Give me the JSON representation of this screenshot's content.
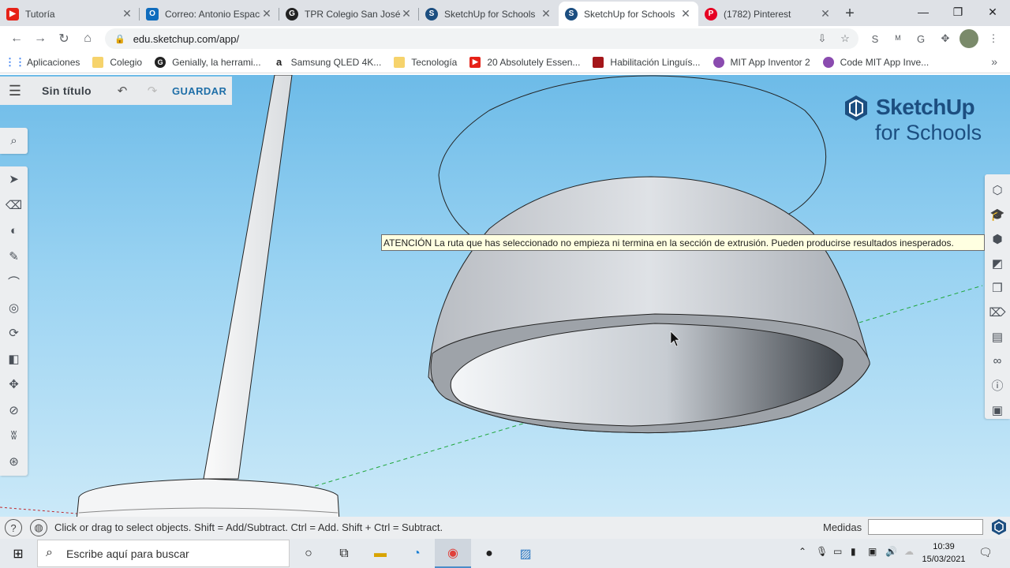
{
  "browser": {
    "tabs": [
      {
        "title": "Tutoría",
        "icon": "youtube-icon",
        "color": "#e62117",
        "active": false
      },
      {
        "title": "Correo: Antonio Espacio",
        "icon": "outlook-icon",
        "color": "#0f6cbd",
        "active": false
      },
      {
        "title": "TPR Colegio San José p",
        "icon": "genially-icon",
        "color": "#222222",
        "active": false
      },
      {
        "title": "SketchUp for Schools",
        "icon": "sketchup-icon",
        "color": "#1c4e80",
        "active": false
      },
      {
        "title": "SketchUp for Schools",
        "icon": "sketchup-icon",
        "color": "#1c4e80",
        "active": true
      },
      {
        "title": "(1782) Pinterest",
        "icon": "pinterest-icon",
        "color": "#e60023",
        "active": false
      }
    ],
    "url": "edu.sketchup.com/app/",
    "bookmarks": [
      {
        "label": "Aplicaciones",
        "icon": "apps-grid-icon",
        "color": "#4285f4"
      },
      {
        "label": "Colegio",
        "icon": "folder-icon",
        "color": "#f6d36c"
      },
      {
        "label": "Genially, la herrami...",
        "icon": "genially-icon",
        "color": "#222222"
      },
      {
        "label": "Samsung QLED 4K...",
        "icon": "amazon-icon",
        "color": "#222222"
      },
      {
        "label": "Tecnología",
        "icon": "folder-icon",
        "color": "#f6d36c"
      },
      {
        "label": "20 Absolutely Essen...",
        "icon": "youtube-icon",
        "color": "#e62117"
      },
      {
        "label": "Habilitación Linguís...",
        "icon": "uv-icon",
        "color": "#a4161a"
      },
      {
        "label": "MIT App Inventor 2",
        "icon": "mit-app-inventor-icon",
        "color": "#8a4baf"
      },
      {
        "label": "Code MIT App Inve...",
        "icon": "mit-app-inventor-icon",
        "color": "#8a4baf"
      }
    ]
  },
  "app": {
    "doc_title": "Sin título",
    "save_label": "GUARDAR",
    "logo_line1": "SketchUp",
    "logo_line2": "for Schools",
    "warning": "ATENCIÓN La ruta que has seleccionado no empieza ni termina en la sección de extrusión. Pueden producirse resultados inesperados.",
    "left_tools": [
      "select-icon",
      "eraser-icon",
      "paint-bucket-icon",
      "pencil-icon",
      "arc-icon",
      "circle-icon",
      "push-pull-icon",
      "offset-icon",
      "move-icon",
      "tape-measure-icon",
      "footprints-icon",
      "orbit-icon"
    ],
    "right_tools": [
      "entity-info-icon",
      "instructor-icon",
      "components-icon",
      "materials-icon",
      "styles-icon",
      "tags-icon",
      "scenes-icon",
      "display-icon",
      "info-icon",
      "outliner-icon"
    ],
    "status_text": "Click or drag to select objects. Shift = Add/Subtract. Ctrl = Add. Shift + Ctrl = Subtract.",
    "measure_label": "Medidas",
    "measure_value": ""
  },
  "taskbar": {
    "search_placeholder": "Escribe aquí para buscar",
    "time": "10:39",
    "date": "15/03/2021"
  }
}
